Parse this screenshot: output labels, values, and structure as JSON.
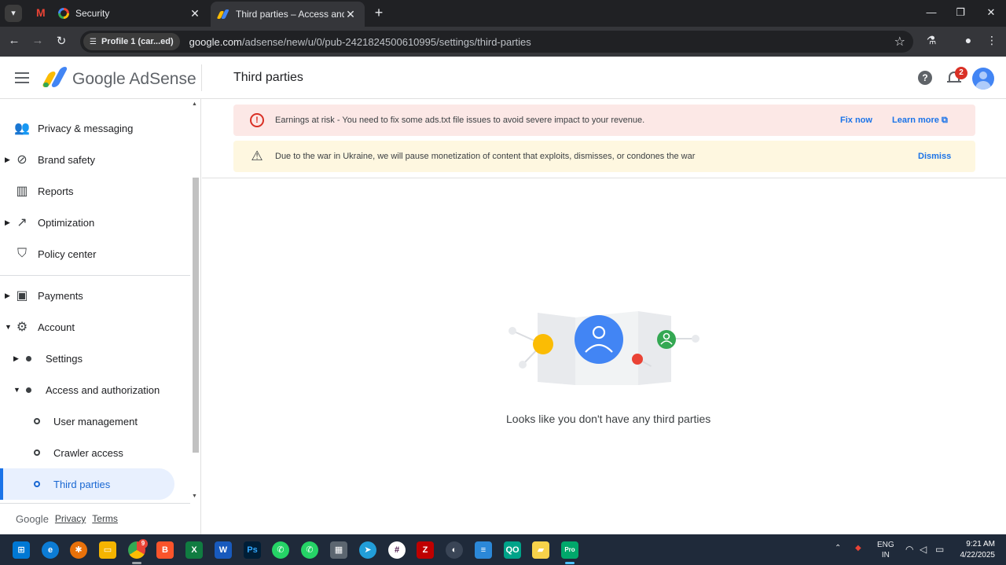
{
  "browser": {
    "tabs": [
      {
        "title": "Security",
        "active": false
      },
      {
        "title": "Third parties – Access and auth",
        "active": true
      }
    ],
    "profile_chip": "Profile 1 (car...ed)",
    "url_host": "google.com",
    "url_path": "/adsense/new/u/0/pub-2421824500610995/settings/third-parties"
  },
  "header": {
    "product_name": "Google AdSense",
    "page_title": "Third parties",
    "notification_count": "2"
  },
  "sidebar": {
    "items": [
      {
        "label": "Privacy & messaging",
        "icon": "people-icon"
      },
      {
        "label": "Brand safety",
        "icon": "block-icon"
      },
      {
        "label": "Reports",
        "icon": "reports-icon"
      },
      {
        "label": "Optimization",
        "icon": "trending-icon"
      },
      {
        "label": "Policy center",
        "icon": "shield-icon"
      },
      {
        "label": "Payments",
        "icon": "payments-icon"
      },
      {
        "label": "Account",
        "icon": "gear-icon"
      },
      {
        "label": "Settings"
      },
      {
        "label": "Access and authorization"
      },
      {
        "label": "User management"
      },
      {
        "label": "Crawler access"
      },
      {
        "label": "Third parties"
      }
    ],
    "footer": {
      "brand": "Google",
      "privacy": "Privacy",
      "terms": "Terms"
    }
  },
  "banners": {
    "error": {
      "text": "Earnings at risk - You need to fix some ads.txt file issues to avoid severe impact to your revenue.",
      "action_primary": "Fix now",
      "action_secondary": "Learn more"
    },
    "warning": {
      "text": "Due to the war in Ukraine, we will pause monetization of content that exploits, dismisses, or condones the war",
      "action": "Dismiss"
    }
  },
  "empty_state": {
    "message": "Looks like you don't have any third parties"
  },
  "taskbar": {
    "language_line1": "ENG",
    "language_line2": "IN",
    "time": "9:21 AM",
    "date": "4/22/2025",
    "chrome_badge": "9"
  },
  "colors": {
    "accent": "#1a73e8",
    "error_bg": "#fce8e6",
    "warn_bg": "#fef7e0",
    "selected_bg": "#e8f0fe"
  }
}
